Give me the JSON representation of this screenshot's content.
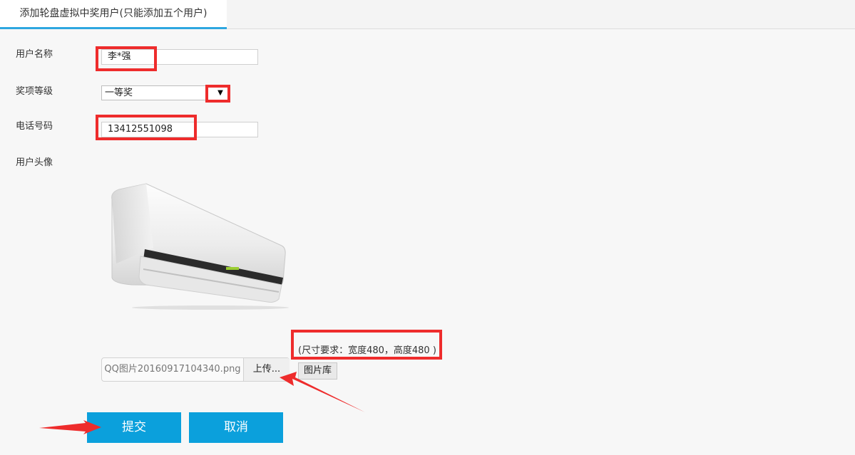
{
  "tab": {
    "title": "添加轮盘虚拟中奖用户(只能添加五个用户)"
  },
  "form": {
    "username_label": "用户名称",
    "username_value": "李*强",
    "prize_label": "奖项等级",
    "prize_selected": "一等奖",
    "phone_label": "电话号码",
    "phone_value": "13412551098",
    "avatar_label": "用户头像",
    "size_hint": "(尺寸要求：宽度480，高度480 )",
    "file_name": "QQ图片20160917104340.png",
    "upload_label": "上传...",
    "library_label": "图片库"
  },
  "actions": {
    "submit_label": "提交",
    "cancel_label": "取消"
  },
  "colors": {
    "accent": "#0ba0dc",
    "annotation": "#ee2c2c",
    "tab_underline": "#2ea7e0"
  }
}
